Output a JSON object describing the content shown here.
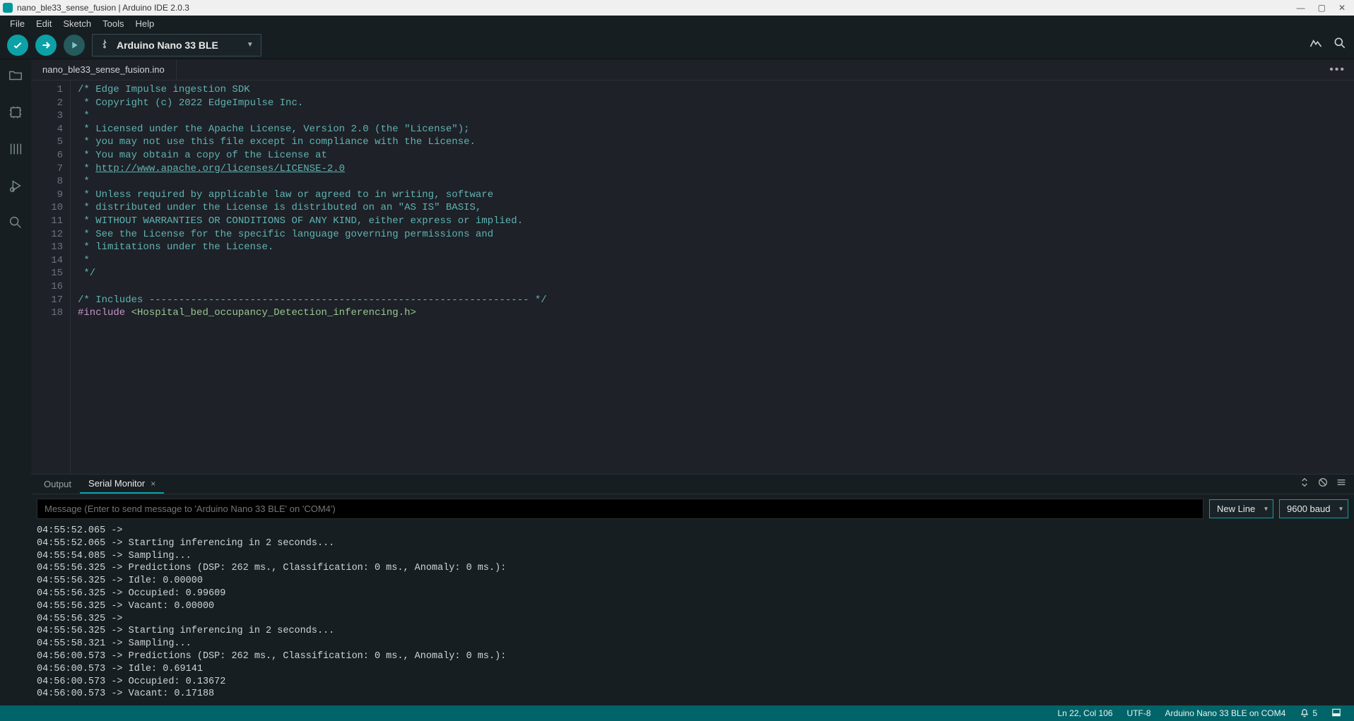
{
  "titlebar": {
    "title": "nano_ble33_sense_fusion | Arduino IDE 2.0.3",
    "win_minimize": "—",
    "win_maximize": "▢",
    "win_close": "✕"
  },
  "menu": {
    "items": [
      "File",
      "Edit",
      "Sketch",
      "Tools",
      "Help"
    ]
  },
  "toolbar": {
    "board_label": "Arduino Nano 33 BLE"
  },
  "sidebar_icons": [
    "folder-icon",
    "board-icon",
    "library-icon",
    "debug-icon",
    "search-icon"
  ],
  "tab": {
    "filename": "nano_ble33_sense_fusion.ino"
  },
  "code_lines": [
    {
      "n": 1,
      "cls": "cmt",
      "t": "/* Edge Impulse ingestion SDK"
    },
    {
      "n": 2,
      "cls": "cmt",
      "t": " * Copyright (c) 2022 EdgeImpulse Inc."
    },
    {
      "n": 3,
      "cls": "cmt",
      "t": " *"
    },
    {
      "n": 4,
      "cls": "cmt",
      "t": " * Licensed under the Apache License, Version 2.0 (the \"License\");"
    },
    {
      "n": 5,
      "cls": "cmt",
      "t": " * you may not use this file except in compliance with the License."
    },
    {
      "n": 6,
      "cls": "cmt",
      "t": " * You may obtain a copy of the License at"
    },
    {
      "n": 7,
      "cls": "url",
      "t": " * http://www.apache.org/licenses/LICENSE-2.0"
    },
    {
      "n": 8,
      "cls": "cmt",
      "t": " *"
    },
    {
      "n": 9,
      "cls": "cmt",
      "t": " * Unless required by applicable law or agreed to in writing, software"
    },
    {
      "n": 10,
      "cls": "cmt",
      "t": " * distributed under the License is distributed on an \"AS IS\" BASIS,"
    },
    {
      "n": 11,
      "cls": "cmt",
      "t": " * WITHOUT WARRANTIES OR CONDITIONS OF ANY KIND, either express or implied."
    },
    {
      "n": 12,
      "cls": "cmt",
      "t": " * See the License for the specific language governing permissions and"
    },
    {
      "n": 13,
      "cls": "cmt",
      "t": " * limitations under the License."
    },
    {
      "n": 14,
      "cls": "cmt",
      "t": " *"
    },
    {
      "n": 15,
      "cls": "cmt",
      "t": " */"
    },
    {
      "n": 16,
      "cls": "",
      "t": ""
    },
    {
      "n": 17,
      "cls": "cmt",
      "t": "/* Includes ---------------------------------------------------------------- */"
    },
    {
      "n": 18,
      "cls": "pp",
      "t": "#include ",
      "tail_cls": "inc",
      "tail": "<Hospital_bed_occupancy_Detection_inferencing.h>"
    }
  ],
  "panel": {
    "tab_output": "Output",
    "tab_serial": "Serial Monitor",
    "close_x": "×",
    "input_placeholder": "Message (Enter to send message to 'Arduino Nano 33 BLE' on 'COM4')",
    "line_ending": "New Line",
    "baud": "9600 baud"
  },
  "serial_lines": [
    "04:55:52.065 ->",
    "04:55:52.065 -> Starting inferencing in 2 seconds...",
    "04:55:54.085 -> Sampling...",
    "04:55:56.325 -> Predictions (DSP: 262 ms., Classification: 0 ms., Anomaly: 0 ms.):",
    "04:55:56.325 -> Idle: 0.00000",
    "04:55:56.325 -> Occupied: 0.99609",
    "04:55:56.325 -> Vacant: 0.00000",
    "04:55:56.325 ->",
    "04:55:56.325 -> Starting inferencing in 2 seconds...",
    "04:55:58.321 -> Sampling...",
    "04:56:00.573 -> Predictions (DSP: 262 ms., Classification: 0 ms., Anomaly: 0 ms.):",
    "04:56:00.573 -> Idle: 0.69141",
    "04:56:00.573 -> Occupied: 0.13672",
    "04:56:00.573 -> Vacant: 0.17188"
  ],
  "status": {
    "pos": "Ln 22, Col 106",
    "encoding": "UTF-8",
    "board": "Arduino Nano 33 BLE on COM4",
    "notif_count": "5"
  }
}
